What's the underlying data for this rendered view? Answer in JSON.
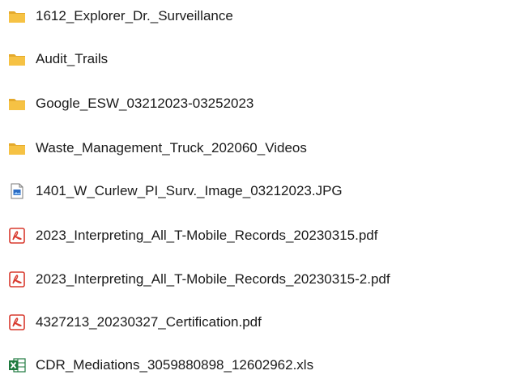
{
  "files": [
    {
      "name": "1612_Explorer_Dr._Surveillance",
      "type": "folder",
      "icon": "folder-icon"
    },
    {
      "name": "Audit_Trails",
      "type": "folder",
      "icon": "folder-icon"
    },
    {
      "name": "Google_ESW_03212023-03252023",
      "type": "folder",
      "icon": "folder-icon"
    },
    {
      "name": "Waste_Management_Truck_202060_Videos",
      "type": "folder",
      "icon": "folder-icon"
    },
    {
      "name": "1401_W_Curlew_PI_Surv._Image_03212023.JPG",
      "type": "image",
      "icon": "image-file-icon"
    },
    {
      "name": "2023_Interpreting_All_T-Mobile_Records_20230315.pdf",
      "type": "pdf",
      "icon": "pdf-file-icon"
    },
    {
      "name": "2023_Interpreting_All_T-Mobile_Records_20230315-2.pdf",
      "type": "pdf",
      "icon": "pdf-file-icon"
    },
    {
      "name": "4327213_20230327_Certification.pdf",
      "type": "pdf",
      "icon": "pdf-file-icon"
    },
    {
      "name": "CDR_Mediations_3059880898_12602962.xls",
      "type": "spreadsheet",
      "icon": "excel-file-icon"
    }
  ],
  "colors": {
    "folder": "#f6c244",
    "folder_shade": "#e4a92c",
    "pdf": "#d83a2f",
    "excel": "#1f7a3f",
    "image": "#2b6cc4"
  }
}
